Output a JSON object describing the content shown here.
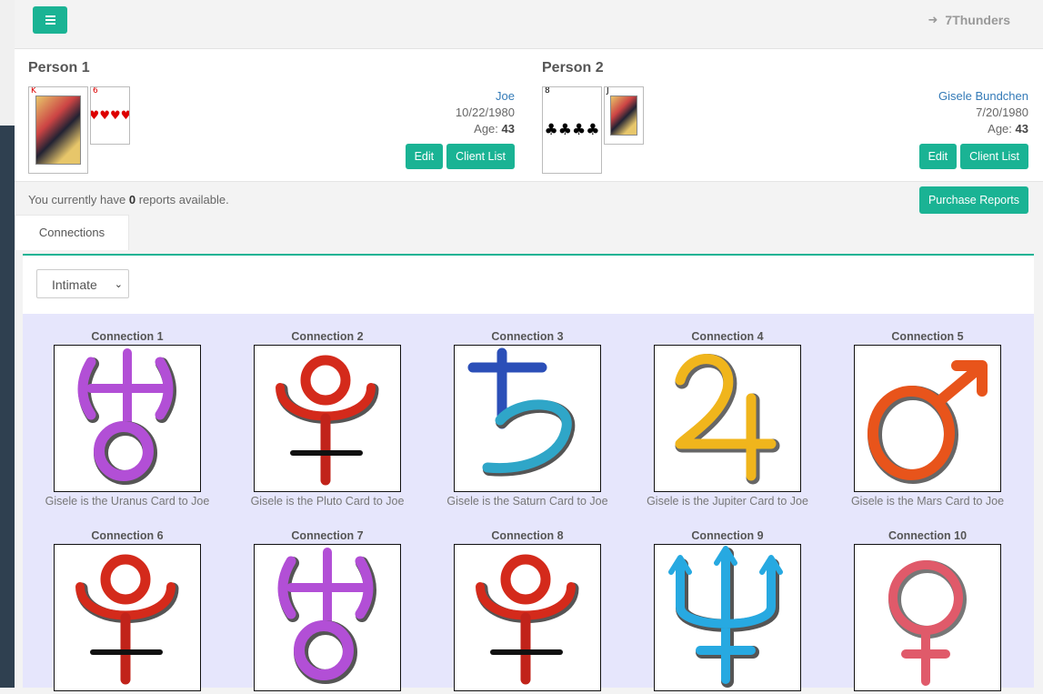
{
  "header": {
    "menu_icon": "hamburger-icon",
    "user_icon": "sign-out-icon",
    "username": "7Thunders"
  },
  "person1": {
    "heading": "Person 1",
    "birth_card": {
      "rank": "K",
      "suit": "hearts"
    },
    "planet_card": {
      "rank": "6",
      "suit": "hearts"
    },
    "name": "Joe",
    "birthdate": "10/22/1980",
    "age_label": "Age:",
    "age": "43",
    "edit_label": "Edit",
    "client_list_label": "Client List"
  },
  "person2": {
    "heading": "Person 2",
    "birth_card": {
      "rank": "8",
      "suit": "clubs"
    },
    "planet_card": {
      "rank": "J",
      "suit": "spades"
    },
    "name": "Gisele Bundchen",
    "birthdate": "7/20/1980",
    "age_label": "Age:",
    "age": "43",
    "edit_label": "Edit",
    "client_list_label": "Client List"
  },
  "reports": {
    "prefix": "You currently have",
    "count": "0",
    "suffix": "reports available.",
    "purchase_label": "Purchase Reports"
  },
  "tabs": [
    {
      "label": "Connections"
    }
  ],
  "filter": {
    "selected": "Intimate"
  },
  "colors": {
    "accent": "#1ab394",
    "grid_bg": "#e6e6fc",
    "link": "#337ab7"
  },
  "connections": [
    {
      "title": "Connection 1",
      "symbol": "uranus-symbol",
      "caption": "Gisele is the Uranus Card to Joe"
    },
    {
      "title": "Connection 2",
      "symbol": "pluto-symbol",
      "caption": "Gisele is the Pluto Card to Joe"
    },
    {
      "title": "Connection 3",
      "symbol": "saturn-symbol",
      "caption": "Gisele is the Saturn Card to Joe"
    },
    {
      "title": "Connection 4",
      "symbol": "jupiter-symbol",
      "caption": "Gisele is the Jupiter Card to Joe"
    },
    {
      "title": "Connection 5",
      "symbol": "mars-symbol",
      "caption": "Gisele is the Mars Card to Joe"
    },
    {
      "title": "Connection 6",
      "symbol": "pluto-symbol",
      "caption": ""
    },
    {
      "title": "Connection 7",
      "symbol": "uranus-symbol",
      "caption": ""
    },
    {
      "title": "Connection 8",
      "symbol": "pluto-symbol",
      "caption": ""
    },
    {
      "title": "Connection 9",
      "symbol": "neptune-symbol",
      "caption": ""
    },
    {
      "title": "Connection 10",
      "symbol": "venus-symbol",
      "caption": ""
    }
  ]
}
